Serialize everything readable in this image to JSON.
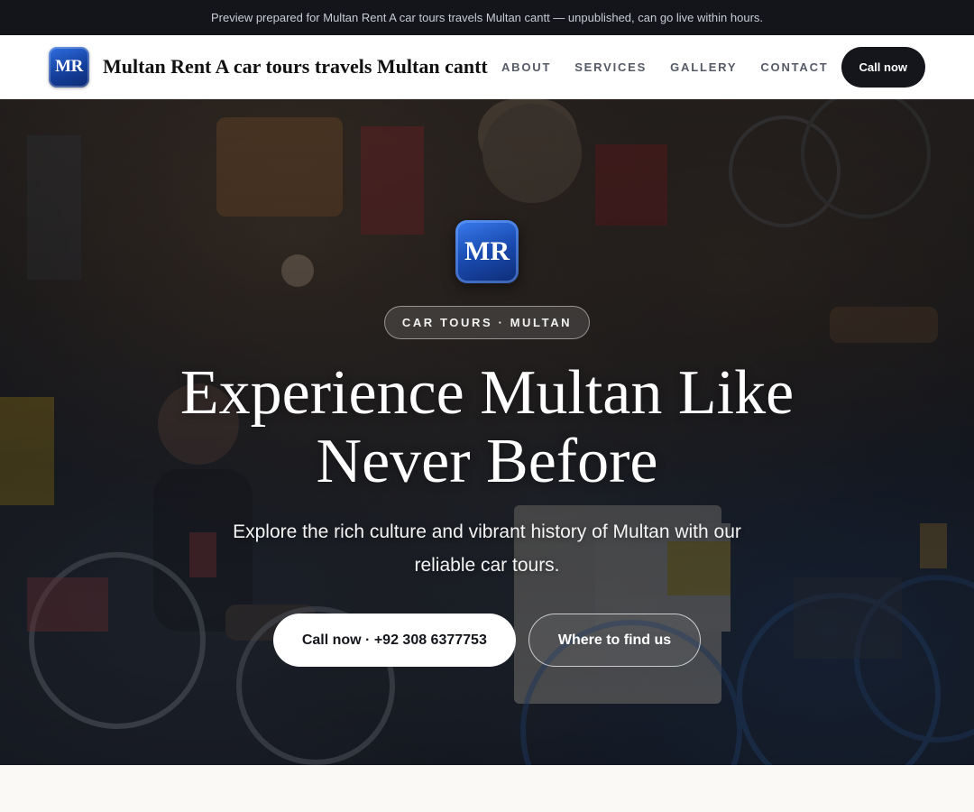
{
  "preview_bar": {
    "text": "Preview prepared for Multan Rent A car tours travels Multan cantt — unpublished, can go live within hours."
  },
  "navbar": {
    "logo_text": "MR",
    "brand_name": "Multan Rent A car tours travels Multan cantt",
    "links": [
      "ABOUT",
      "SERVICES",
      "GALLERY",
      "CONTACT"
    ],
    "cta_label": "Call now"
  },
  "hero": {
    "logo_text": "MR",
    "badge": "CAR TOURS · MULTAN",
    "headline": "Experience Multan Like Never Before",
    "subline": "Explore the rich culture and vibrant history of Multan with our reliable car tours.",
    "primary_cta": "Call now · +92 308 6377753",
    "secondary_cta": "Where to find us",
    "background_image": "market-street-bicycles-photo"
  },
  "colors": {
    "preview_bar_bg": "#13151b",
    "nav_cta_bg": "#14161c",
    "logo_blue": "#1a4bb0",
    "page_bg": "#faf9f6"
  }
}
